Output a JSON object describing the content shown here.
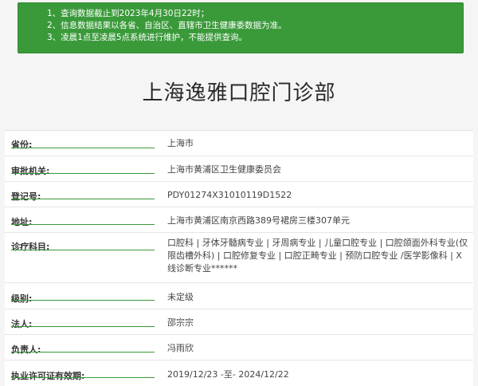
{
  "notice": {
    "lines": [
      "1、查询数据截止到2023年4月30日22时；",
      "2、信息数据结果以各省、自治区、直辖市卫生健康委数据为准。",
      "3、凌晨1点至凌晨5点系统进行维护，不能提供查询。"
    ]
  },
  "title": "上海逸雅口腔门诊部",
  "fields": [
    {
      "label": "省份:",
      "value": "上海市"
    },
    {
      "label": "审批机关:",
      "value": "上海市黄浦区卫生健康委员会"
    },
    {
      "label": "登记号:",
      "value": "PDY01274X31010119D1522"
    },
    {
      "label": "地址:",
      "value": "上海市黄浦区南京西路389号裙房三楼307单元"
    },
    {
      "label": "诊疗科目:",
      "value": "口腔科 | 牙体牙髓病专业 | 牙周病专业 | 儿童口腔专业 | 口腔颌面外科专业(仅限齿槽外科) | 口腔修复专业 | 口腔正畸专业 | 预防口腔专业 /医学影像科 | X线诊断专业******"
    },
    {
      "label": "级别:",
      "value": "未定级"
    },
    {
      "label": "法人:",
      "value": "邵宗宗"
    },
    {
      "label": "负责人:",
      "value": "冯雨欣"
    },
    {
      "label": "执业许可证有效期:",
      "value": "2019/12/23 -至- 2024/12/22"
    }
  ]
}
